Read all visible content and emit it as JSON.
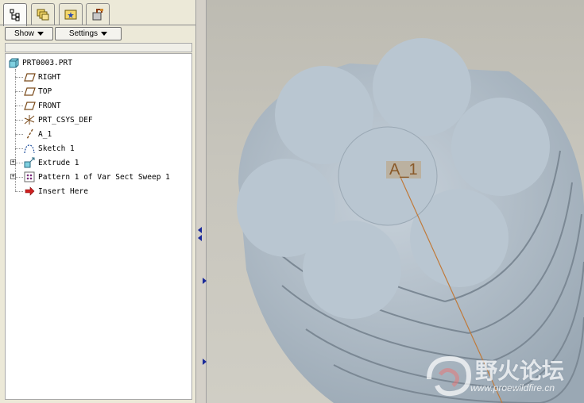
{
  "navigator": {
    "tabs": [
      {
        "name": "model-tree",
        "icon": "model-tree-icon"
      },
      {
        "name": "folder-browser",
        "icon": "folder-browser-icon"
      },
      {
        "name": "favorites",
        "icon": "favorites-icon"
      },
      {
        "name": "connections",
        "icon": "connections-icon"
      }
    ],
    "toolbar": {
      "show_label": "Show",
      "settings_label": "Settings"
    },
    "tree": {
      "root": "PRT0003.PRT",
      "items": [
        {
          "label": "RIGHT",
          "icon": "datum-plane-icon"
        },
        {
          "label": "TOP",
          "icon": "datum-plane-icon"
        },
        {
          "label": "FRONT",
          "icon": "datum-plane-icon"
        },
        {
          "label": "PRT_CSYS_DEF",
          "icon": "coordinate-system-icon"
        },
        {
          "label": "A_1",
          "icon": "datum-axis-icon"
        },
        {
          "label": "Sketch 1",
          "icon": "sketch-icon"
        },
        {
          "label": "Extrude 1",
          "icon": "extrude-icon",
          "expandable": true
        },
        {
          "label": "Pattern 1 of Var Sect Sweep 1",
          "icon": "pattern-icon",
          "expandable": true
        },
        {
          "label": "Insert Here",
          "icon": "insert-here-arrow-icon"
        }
      ]
    }
  },
  "viewport": {
    "axis_label": "A_1",
    "watermark": {
      "title": "野火论坛",
      "url": "www.proewildfire.cn"
    },
    "colors": {
      "model": "#b9c6d1",
      "axis": "#c07a3a",
      "accent_arrow": "#1a2a9a"
    }
  }
}
